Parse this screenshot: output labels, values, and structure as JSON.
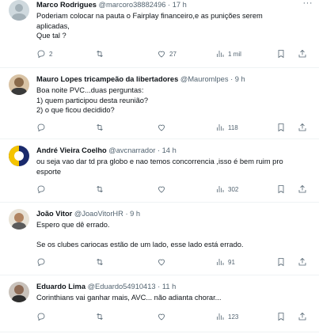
{
  "tweets": [
    {
      "name": "Marco Rodrigues",
      "handle": "@marcoro38882496",
      "time": "17 h",
      "lines": [
        "Poderiam colocar na pauta o Fairplay financeiro,e as punições  serem",
        "aplicadas,",
        "Que tal ?"
      ],
      "replies": "2",
      "retweets": "",
      "likes": "27",
      "views": "1 mil"
    },
    {
      "name": "Mauro Lopes tricampeão da libertadores",
      "handle": "@Mauromlpes",
      "time": "9 h",
      "lines": [
        "Boa noite PVC...duas perguntas:",
        "1) quem participou desta reunião?",
        "2) o que ficou decidido?"
      ],
      "replies": "",
      "retweets": "",
      "likes": "",
      "views": "118"
    },
    {
      "name": "André Vieira Coelho",
      "handle": "@avcnarrador",
      "time": "14 h",
      "lines": [
        "ou seja vao dar td pra globo e nao temos concorrencia ,isso é bem ruim pro",
        "esporte"
      ],
      "replies": "",
      "retweets": "",
      "likes": "",
      "views": "302"
    },
    {
      "name": "João Vitor",
      "handle": "@JoaoVitorHR",
      "time": "9 h",
      "lines": [
        "Espero que dê errado.",
        "",
        "Se os clubes cariocas estão de um lado, esse lado está errado."
      ],
      "replies": "",
      "retweets": "",
      "likes": "",
      "views": "91"
    },
    {
      "name": "Eduardo Lima",
      "handle": "@Eduardo54910413",
      "time": "11 h",
      "lines": [
        "Corinthians vai ganhar mais, AVC... não adianta chorar..."
      ],
      "replies": "",
      "retweets": "",
      "likes": "",
      "views": "123"
    }
  ],
  "dot": "·",
  "more_glyph": "···",
  "icons": {
    "reply": "reply-icon",
    "retweet": "retweet-icon",
    "like": "heart-icon",
    "views": "views-chart-icon",
    "bookmark": "bookmark-icon",
    "share": "share-icon"
  },
  "colors": {
    "text": "#0f1419",
    "secondary": "#536471",
    "divider": "#eff3f4"
  }
}
